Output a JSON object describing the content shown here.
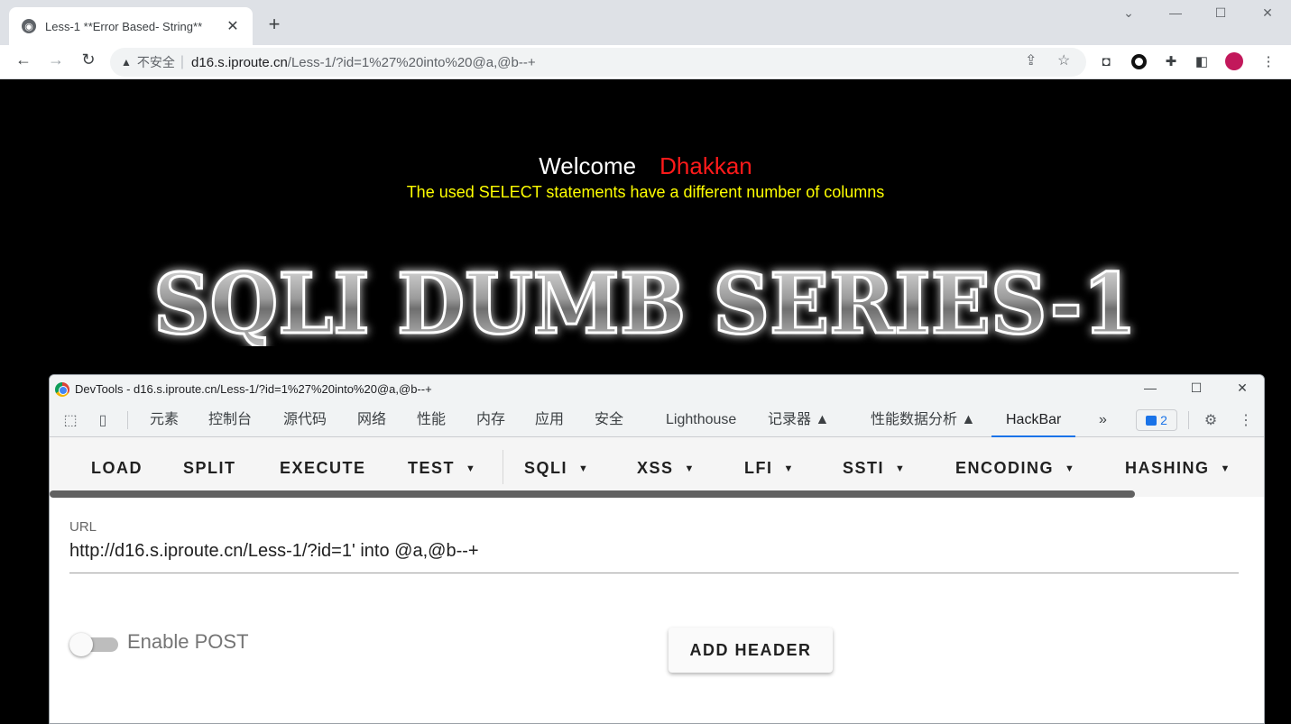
{
  "browser": {
    "tab_title": "Less-1 **Error Based- String**",
    "tab_close": "✕",
    "new_tab": "+",
    "address": {
      "insecure_label": "不安全",
      "host": "d16.s.iproute.cn",
      "path": "/Less-1/?id=1%27%20into%20@a,@b--+"
    }
  },
  "page": {
    "welcome_label": "Welcome",
    "welcome_name": "Dhakkan",
    "error_message": "The used SELECT statements have a different number of columns",
    "banner_text": "SQLI DUMB SERIES-1"
  },
  "devtools": {
    "window_title": "DevTools - d16.s.iproute.cn/Less-1/?id=1%27%20into%20@a,@b--+",
    "tabs": [
      "元素",
      "控制台",
      "源代码",
      "网络",
      "性能",
      "内存",
      "应用",
      "安全",
      "Lighthouse",
      "记录器 ▲",
      "性能数据分析 ▲",
      "HackBar"
    ],
    "more_tabs": "»",
    "issues_count": "2",
    "active_tab": "HackBar"
  },
  "hackbar": {
    "menu": [
      "LOAD",
      "SPLIT",
      "EXECUTE",
      "TEST",
      "SQLI",
      "XSS",
      "LFI",
      "SSTI",
      "ENCODING",
      "HASHING"
    ],
    "caret": "▼",
    "url_label": "URL",
    "url_value": "http://d16.s.iproute.cn/Less-1/?id=1' into @a,@b--+",
    "post_label": "Enable POST",
    "post_enabled": false,
    "add_header_label": "ADD HEADER"
  },
  "colors": {
    "welcome_name": "#ff1a1a",
    "error_message": "#ffff00",
    "active_tab_underline": "#1a73e8"
  }
}
